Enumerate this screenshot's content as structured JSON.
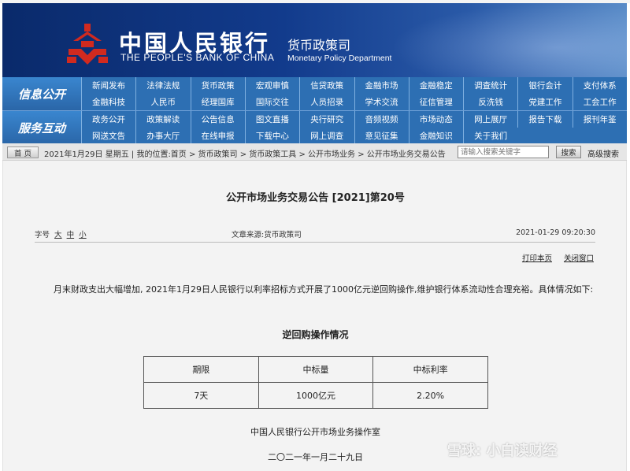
{
  "header": {
    "bank_name_cn": "中国人民银行",
    "bank_name_en": "THE PEOPLE'S BANK OF CHINA",
    "dept_cn": "货币政策司",
    "dept_en": "Monetary Policy Department"
  },
  "nav": {
    "row1": {
      "category": "信息公开",
      "links": [
        "新闻发布",
        "法律法规",
        "货币政策",
        "宏观审慎",
        "信贷政策",
        "金融市场",
        "金融稳定",
        "调查统计",
        "银行会计",
        "支付体系",
        "金融科技",
        "人民币",
        "经理国库",
        "国际交往",
        "人员招录",
        "学术交流",
        "征信管理",
        "反洗钱",
        "党建工作",
        "工会工作"
      ]
    },
    "row2": {
      "category": "服务互动",
      "links": [
        "政务公开",
        "政策解读",
        "公告信息",
        "图文直播",
        "央行研究",
        "音频视频",
        "市场动态",
        "网上展厅",
        "报告下载",
        "报刊年鉴",
        "网送文告",
        "办事大厅",
        "在线申报",
        "下载中心",
        "网上调查",
        "意见征集",
        "金融知识",
        "关于我们"
      ]
    }
  },
  "breadcrumb": {
    "home_label": "首 页",
    "text": "2021年1月29日 星期五 | 我的位置:首页 > 货币政策司 > 货币政策工具 > 公开市场业务 > 公开市场业务交易公告",
    "search_placeholder": "请输入搜索关键字",
    "search_button": "搜索",
    "advanced_search": "高级搜索"
  },
  "article": {
    "title": "公开市场业务交易公告 [2021]第20号",
    "font_size_label": "字号",
    "font_sizes": [
      "大",
      "中",
      "小"
    ],
    "source": "文章来源:货币政策司",
    "datetime": "2021-01-29 09:20:30",
    "print_label": "打印本页",
    "close_label": "关闭窗口",
    "paragraph": "月末财政支出大幅增加, 2021年1月29日人民银行以利率招标方式开展了1000亿元逆回购操作,维护银行体系流动性合理充裕。具体情况如下:",
    "table_title": "逆回购操作情况",
    "table_headers": [
      "期限",
      "中标量",
      "中标利率"
    ],
    "table_rows": [
      [
        "7天",
        "1000亿元",
        "2.20%"
      ]
    ],
    "signature": "中国人民银行公开市场业务操作室",
    "date_line": "二〇二一年一月二十九日"
  },
  "watermark": "雪球: 小白读财经",
  "colors": {
    "banner": "#123b8c",
    "nav": "#2d6fb3",
    "logo_red": "#d12a1f"
  }
}
